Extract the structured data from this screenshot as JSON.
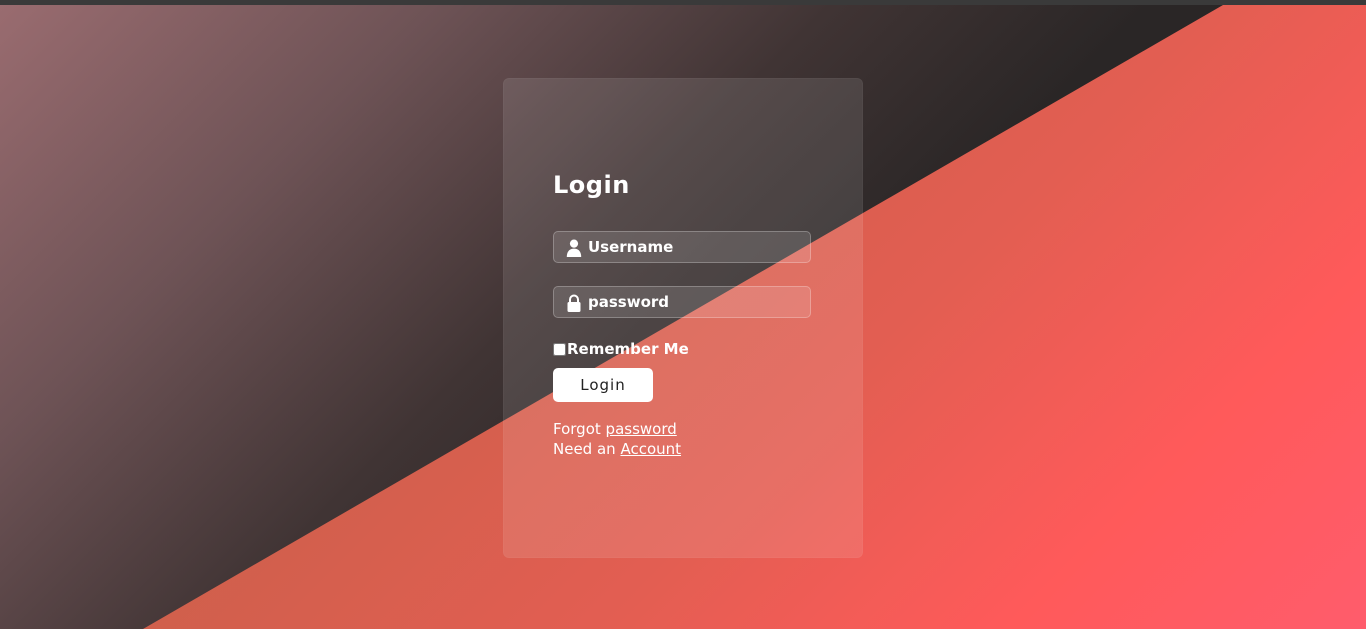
{
  "colors": {
    "card_bg": "rgba(255,255,255,0.11)",
    "coral": "#ff5a5a",
    "dark": "#252323",
    "button_bg": "#ffffff",
    "text": "#ffffff"
  },
  "login_form": {
    "title": "Login",
    "username": {
      "placeholder": "Username",
      "value": "",
      "icon": "user-icon"
    },
    "password": {
      "placeholder": "password",
      "value": "",
      "icon": "lock-icon"
    },
    "remember_me": {
      "label": "Remember Me",
      "checked": false
    },
    "submit_label": "Login",
    "forgot": {
      "text": "Forgot",
      "link_text": "password"
    },
    "signup": {
      "text": "Need an",
      "link_text": "Account"
    }
  }
}
